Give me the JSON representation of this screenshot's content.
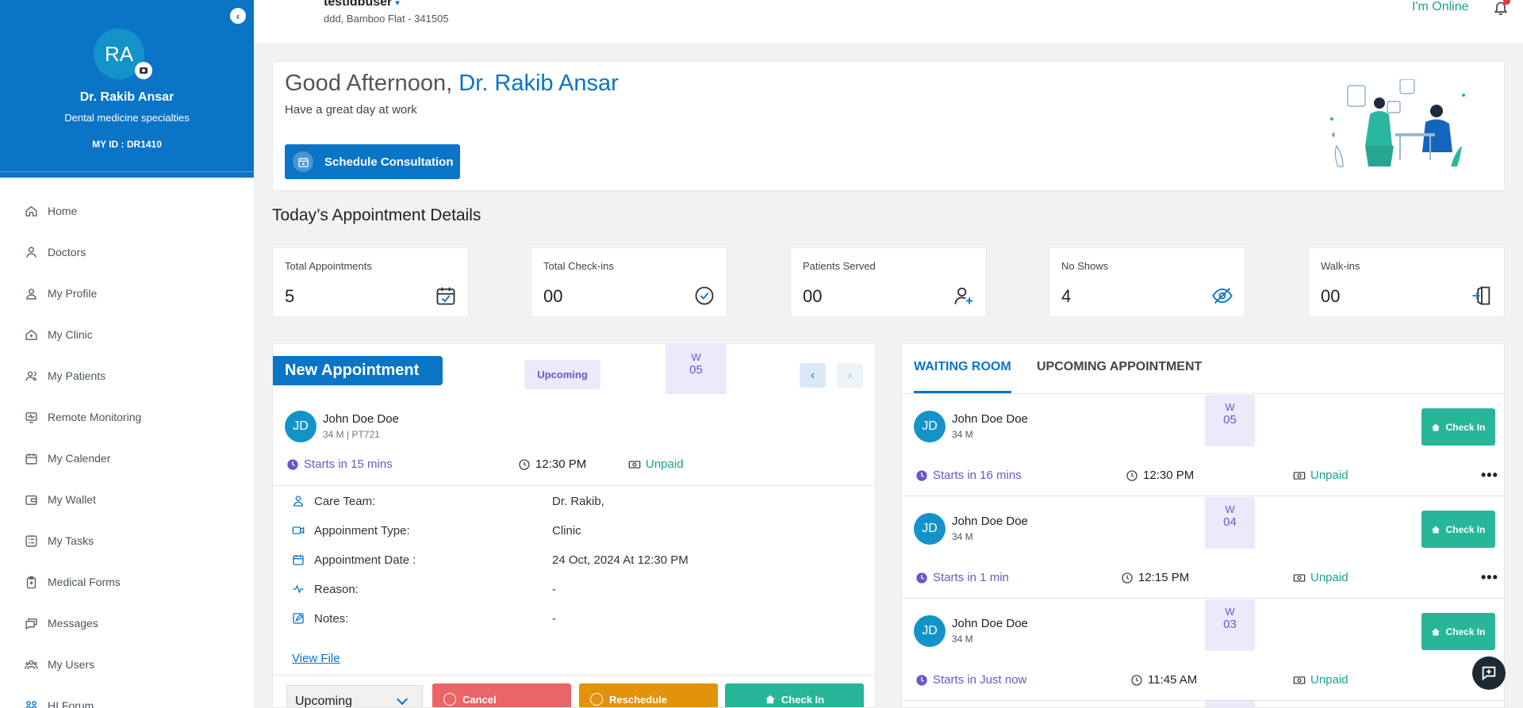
{
  "sidebar": {
    "avatar_initials": "RA",
    "doctor_name": "Dr. Rakib Ansar",
    "specialty": "Dental medicine specialties",
    "my_id": "MY ID : DR1410",
    "collapse_icon": "chevron-left-icon",
    "items": [
      {
        "label": "Home",
        "icon": "home-icon"
      },
      {
        "label": "Doctors",
        "icon": "doctor-icon"
      },
      {
        "label": "My Profile",
        "icon": "user-icon"
      },
      {
        "label": "My Clinic",
        "icon": "clinic-icon"
      },
      {
        "label": "My Patients",
        "icon": "patients-icon"
      },
      {
        "label": "Remote Monitoring",
        "icon": "monitor-icon"
      },
      {
        "label": "My Calender",
        "icon": "calendar-icon"
      },
      {
        "label": "My Wallet",
        "icon": "wallet-icon"
      },
      {
        "label": "My Tasks",
        "icon": "tasks-icon"
      },
      {
        "label": "Medical Forms",
        "icon": "clipboard-icon"
      },
      {
        "label": "Messages",
        "icon": "messages-icon"
      },
      {
        "label": "My Users",
        "icon": "users-icon"
      },
      {
        "label": "HI Forum",
        "icon": "forum-icon"
      }
    ]
  },
  "header": {
    "username": "testidbuser",
    "address": "ddd, Bamboo Flat - 341505",
    "online_label": "I'm Online",
    "bell_icon": "bell-icon"
  },
  "greeting": {
    "prefix": "Good Afternoon, ",
    "name": "Dr. Rakib Ansar",
    "subtitle": "Have a great day at work",
    "schedule_button": "Schedule Consultation"
  },
  "section_title": "Today’s Appointment Details",
  "stats": [
    {
      "label": "Total Appointments",
      "value": "5",
      "icon": "calendar-check-icon"
    },
    {
      "label": "Total Check-ins",
      "value": "00",
      "icon": "check-circle-icon"
    },
    {
      "label": "Patients Served",
      "value": "00",
      "icon": "user-plus-icon"
    },
    {
      "label": "No Shows",
      "value": "4",
      "icon": "eye-off-icon"
    },
    {
      "label": "Walk-ins",
      "value": "00",
      "icon": "door-enter-icon"
    }
  ],
  "appointment": {
    "tag": "New Appointment",
    "status": "Upcoming",
    "w_label": "W",
    "w_number": "05",
    "patient_initials": "JD",
    "patient_name": "John Doe Doe",
    "patient_meta": "34 M | PT721",
    "starts": "Starts in 15 mins",
    "time": "12:30 PM",
    "payment": "Unpaid",
    "details": [
      {
        "label": "Care Team:",
        "value": "Dr. Rakib,",
        "icon": "care-team-icon"
      },
      {
        "label": "Appoinment Type:",
        "value": "Clinic",
        "icon": "video-icon"
      },
      {
        "label": "Appointment Date :",
        "value": "24 Oct, 2024 At 12:30 PM",
        "icon": "calendar-icon"
      },
      {
        "label": "Reason:",
        "value": "-",
        "icon": "pulse-icon"
      },
      {
        "label": "Notes:",
        "value": "-",
        "icon": "edit-icon"
      }
    ],
    "view_file": "View File",
    "select_value": "Upcoming",
    "cancel": "Cancel",
    "reschedule": "Reschedule",
    "check_in": "Check In"
  },
  "waiting": {
    "tab_waiting": "WAITING ROOM",
    "tab_upcoming": "UPCOMING APPOINTMENT",
    "check_in_label": "Check In",
    "w_label": "W",
    "items": [
      {
        "initials": "JD",
        "name": "John Doe Doe",
        "age": "34 M",
        "w": "05",
        "starts": "Starts in 16 mins",
        "time": "12:30 PM",
        "payment": "Unpaid",
        "more": "•••"
      },
      {
        "initials": "JD",
        "name": "John Doe Doe",
        "age": "34 M",
        "w": "04",
        "starts": "Starts in 1 min",
        "time": "12:15 PM",
        "payment": "Unpaid",
        "more": "•••"
      },
      {
        "initials": "JD",
        "name": "John Doe Doe",
        "age": "34 M",
        "w": "03",
        "starts": "Starts in Just now",
        "time": "11:45 AM",
        "payment": "Unpaid",
        "more": ""
      }
    ]
  },
  "colors": {
    "primary": "#0a74c6",
    "teal": "#28b69b",
    "purple": "#6a57c9",
    "cancel": "#e96567",
    "reschedule": "#e3920b"
  }
}
